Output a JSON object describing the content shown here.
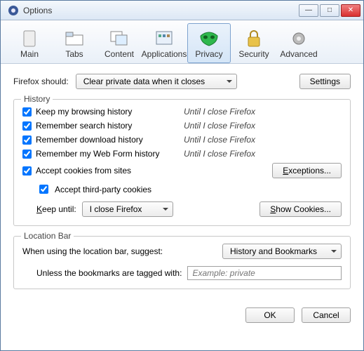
{
  "window": {
    "title": "Options"
  },
  "winbtns": {
    "min": "—",
    "max": "□",
    "close": "✕"
  },
  "tabs": [
    {
      "label": "Main"
    },
    {
      "label": "Tabs"
    },
    {
      "label": "Content"
    },
    {
      "label": "Applications"
    },
    {
      "label": "Privacy",
      "active": true
    },
    {
      "label": "Security"
    },
    {
      "label": "Advanced"
    }
  ],
  "firefox_should": {
    "label": "Firefox should:",
    "value": "Clear private data when it closes"
  },
  "settings_btn": "Settings",
  "history": {
    "legend": "History",
    "items": [
      {
        "label": "Keep my browsing history",
        "until": "Until I close Firefox"
      },
      {
        "label": "Remember search history",
        "until": "Until I close Firefox"
      },
      {
        "label": "Remember download history",
        "until": "Until I close Firefox"
      },
      {
        "label": "Remember my Web Form history",
        "until": "Until I close Firefox"
      }
    ],
    "accept_cookies": "Accept cookies from sites",
    "exceptions_btn": "Exceptions...",
    "accept_third": "Accept third-party cookies",
    "keep_until_label": "Keep until:",
    "keep_until_value": "I close Firefox",
    "show_cookies_btn": "Show Cookies..."
  },
  "location": {
    "legend": "Location Bar",
    "suggest_label": "When using the location bar, suggest:",
    "suggest_value": "History and Bookmarks",
    "unless_label": "Unless the bookmarks are tagged with:",
    "placeholder": "Example: private"
  },
  "dlg": {
    "ok": "OK",
    "cancel": "Cancel"
  }
}
